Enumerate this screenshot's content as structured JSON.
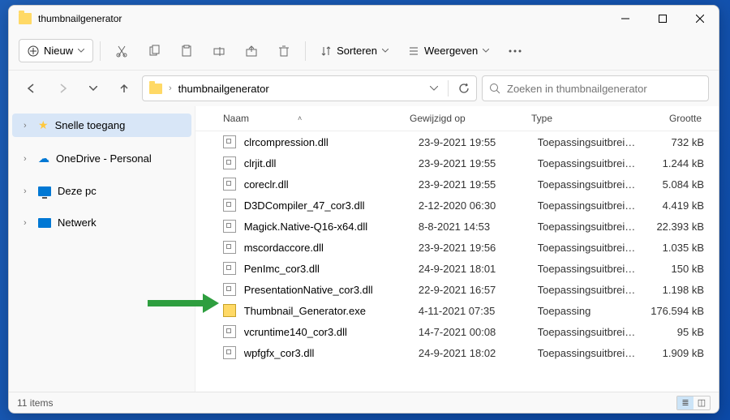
{
  "window": {
    "title": "thumbnailgenerator"
  },
  "toolbar": {
    "new": "Nieuw",
    "sort": "Sorteren",
    "view": "Weergeven"
  },
  "address": {
    "path": "thumbnailgenerator"
  },
  "search": {
    "placeholder": "Zoeken in thumbnailgenerator"
  },
  "sidebar": {
    "quick": "Snelle toegang",
    "onedrive": "OneDrive - Personal",
    "pc": "Deze pc",
    "network": "Netwerk"
  },
  "columns": {
    "name": "Naam",
    "date": "Gewijzigd op",
    "type": "Type",
    "size": "Grootte"
  },
  "files": [
    {
      "name": "clrcompression.dll",
      "date": "23-9-2021 19:55",
      "type": "Toepassingsuitbreidi...",
      "size": "732 kB",
      "kind": "dll"
    },
    {
      "name": "clrjit.dll",
      "date": "23-9-2021 19:55",
      "type": "Toepassingsuitbreidi...",
      "size": "1.244 kB",
      "kind": "dll"
    },
    {
      "name": "coreclr.dll",
      "date": "23-9-2021 19:55",
      "type": "Toepassingsuitbreidi...",
      "size": "5.084 kB",
      "kind": "dll"
    },
    {
      "name": "D3DCompiler_47_cor3.dll",
      "date": "2-12-2020 06:30",
      "type": "Toepassingsuitbreidi...",
      "size": "4.419 kB",
      "kind": "dll"
    },
    {
      "name": "Magick.Native-Q16-x64.dll",
      "date": "8-8-2021 14:53",
      "type": "Toepassingsuitbreidi...",
      "size": "22.393 kB",
      "kind": "dll"
    },
    {
      "name": "mscordaccore.dll",
      "date": "23-9-2021 19:56",
      "type": "Toepassingsuitbreidi...",
      "size": "1.035 kB",
      "kind": "dll"
    },
    {
      "name": "PenImc_cor3.dll",
      "date": "24-9-2021 18:01",
      "type": "Toepassingsuitbreidi...",
      "size": "150 kB",
      "kind": "dll"
    },
    {
      "name": "PresentationNative_cor3.dll",
      "date": "22-9-2021 16:57",
      "type": "Toepassingsuitbreidi...",
      "size": "1.198 kB",
      "kind": "dll"
    },
    {
      "name": "Thumbnail_Generator.exe",
      "date": "4-11-2021 07:35",
      "type": "Toepassing",
      "size": "176.594 kB",
      "kind": "exe"
    },
    {
      "name": "vcruntime140_cor3.dll",
      "date": "14-7-2021 00:08",
      "type": "Toepassingsuitbreidi...",
      "size": "95 kB",
      "kind": "dll"
    },
    {
      "name": "wpfgfx_cor3.dll",
      "date": "24-9-2021 18:02",
      "type": "Toepassingsuitbreidi...",
      "size": "1.909 kB",
      "kind": "dll"
    }
  ],
  "status": {
    "count": "11 items"
  }
}
